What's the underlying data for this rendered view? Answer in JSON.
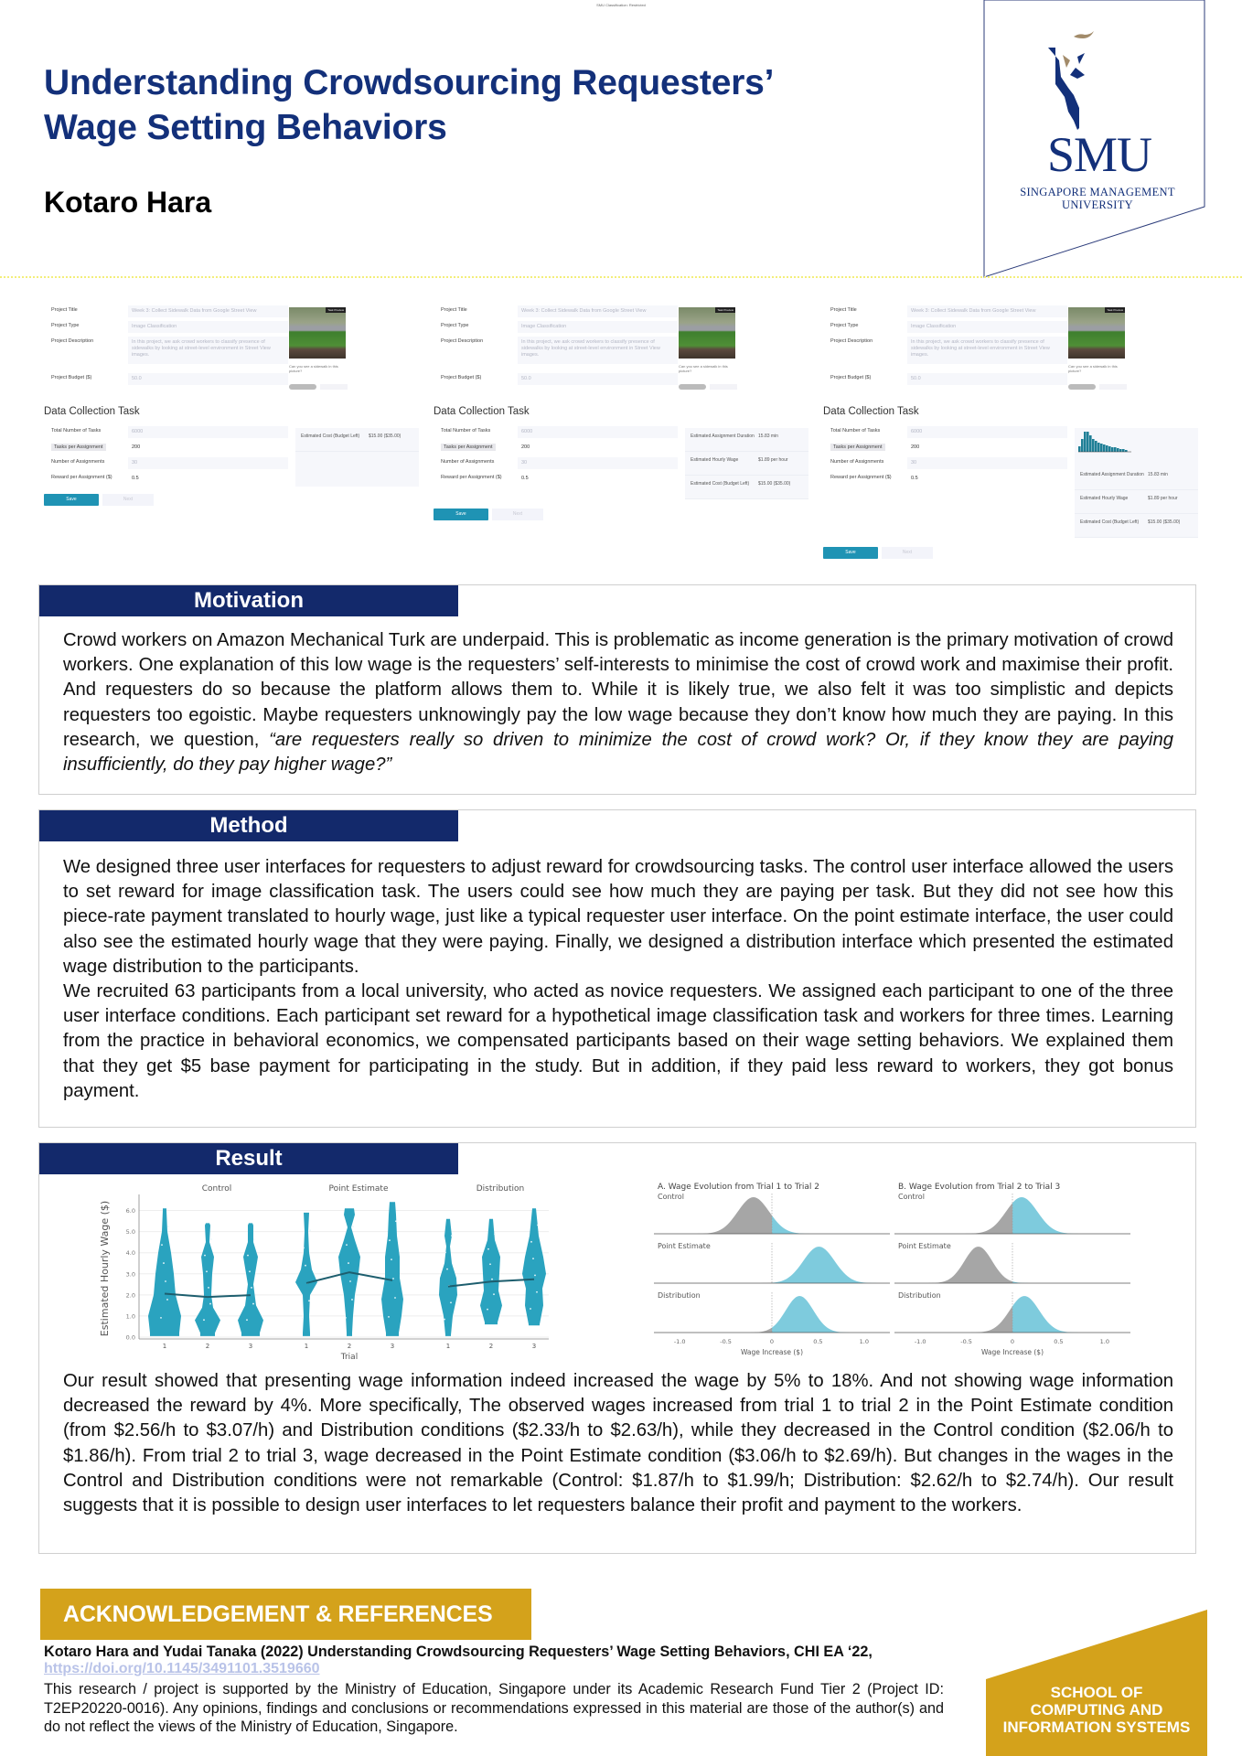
{
  "classification": "SMU Classification: Restricted",
  "header": {
    "title_line1": "Understanding Crowdsourcing Requesters’",
    "title_line2": "Wage Setting Behaviors",
    "author": "Kotaro Hara",
    "logo": {
      "name": "SMU",
      "subtitle_line1": "SINGAPORE MANAGEMENT",
      "subtitle_line2": "UNIVERSITY"
    }
  },
  "ui_screenshots": {
    "project_fields": [
      {
        "label": "Project Title",
        "value": "Week 3: Collect Sidewalk Data from Google Street View"
      },
      {
        "label": "Project Type",
        "value": "Image Classification"
      },
      {
        "label": "Project Description",
        "value": "In this project, we ask crowd workers to classify presence of sidewalks by looking at street-level environment in Street View images."
      },
      {
        "label": "Project Budget ($)",
        "value": "50.0"
      }
    ],
    "preview": {
      "tag": "Task Preview",
      "question": "Can you see a sidewalk in this picture?",
      "yes": "Yes",
      "no": "No"
    },
    "section_title": "Data Collection Task",
    "task_fields": [
      {
        "label": "Total Number of Tasks",
        "value": "6000"
      },
      {
        "label": "Tasks per Assignment",
        "value": "200"
      },
      {
        "label": "Number of Assignments",
        "value": "30"
      },
      {
        "label": "Reward per Assignment ($)",
        "value": "0.5"
      }
    ],
    "side_info": {
      "duration_label": "Estimated Assignment Duration",
      "duration_value": "15.83 min",
      "wage_label": "Estimated Hourly Wage",
      "wage_value": "$1.89 per hour",
      "cost_label": "Estimated Cost (Budget Left)",
      "cost_value": "$15.00 ($35.00)"
    },
    "histogram_axis": {
      "min": "0",
      "max": "100"
    },
    "save_label": "Save",
    "next_label": "Next",
    "variants": [
      "Control",
      "Point Estimate",
      "Distribution"
    ]
  },
  "motivation": {
    "heading": "Motivation",
    "text": "Crowd workers on Amazon Mechanical Turk are underpaid. This is problematic as income generation is the primary motivation of crowd workers. One explanation of this low wage is the requesters’ self-interests to minimise the cost of crowd work and maximise their profit. And requesters do so because the platform allows them to. While it is likely true, we also felt it was too simplistic and depicts requesters too egoistic. Maybe requesters unknowingly pay the low wage because they don’t know how much they are paying. In this research, we question, ",
    "question": "“are requesters really so driven to minimize the cost of crowd work? Or, if they know they are paying insufficiently, do they pay higher wage?”"
  },
  "method": {
    "heading": "Method",
    "paragraph1": "We designed three user interfaces for requesters to adjust reward for crowdsourcing tasks. The control user interface allowed the users to set reward for image classification task. The users could see how much they are paying per task. But they did not see how this piece-rate payment translated to hourly wage, just like a typical requester user interface. On the point estimate interface, the user could also see the estimated hourly wage that they were paying. Finally, we designed a distribution interface which presented the estimated wage distribution to the participants.",
    "paragraph2": "We recruited 63 participants from a local university, who acted as novice requesters. We assigned each participant to one of the three user interface conditions. Each participant set reward for a hypothetical image classification task and workers for three times. Learning from the practice in behavioral economics, we compensated participants based on their wage setting behaviors. We explained them that they get $5 base payment for participating in the study. But in addition, if they paid less reward to workers, they got bonus payment."
  },
  "result": {
    "heading": "Result",
    "text": "Our result showed that presenting wage information indeed increased the wage by 5% to 18%. And not showing wage information decreased the reward by 4%. More specifically, The observed wages increased from trial 1 to trial 2 in the Point Estimate condition (from $2.56/h to $3.07/h) and Distribution conditions ($2.33/h to $2.63/h), while they decreased in the Control condition ($2.06/h to $1.86/h). From trial 2 to trial 3, wage decreased in the Point Estimate condition ($3.06/h to $2.69/h). But changes in the wages in the Control and Distribution conditions were not remarkable (Control: $1.87/h to $1.99/h; Distribution: $2.62/h to $2.74/h). Our result suggests that it is possible to design user interfaces to let requesters balance their profit and payment to the workers."
  },
  "chart_data": [
    {
      "type": "violin",
      "title": "",
      "xlabel": "Trial",
      "ylabel": "Estimated Hourly Wage ($)",
      "ylim": [
        0,
        6.5
      ],
      "yticks": [
        "0.0",
        "1.0",
        "2.0",
        "3.0",
        "4.0",
        "5.0",
        "6.0"
      ],
      "categories": [
        "1",
        "2",
        "3"
      ],
      "color": "#2aa3bf",
      "panels": [
        {
          "name": "Control",
          "means": [
            2.06,
            1.9,
            1.99
          ],
          "max": [
            6.1,
            5.4,
            5.4
          ],
          "min": [
            0.05,
            0.05,
            0.05
          ]
        },
        {
          "name": "Point Estimate",
          "means": [
            2.56,
            3.07,
            2.69
          ],
          "max": [
            5.9,
            6.1,
            6.4
          ],
          "min": [
            0.05,
            0.05,
            0.05
          ]
        },
        {
          "name": "Distribution",
          "means": [
            2.4,
            2.63,
            2.74
          ],
          "max": [
            5.6,
            5.6,
            6.1
          ],
          "min": [
            0.05,
            0.6,
            0.55
          ]
        }
      ]
    },
    {
      "type": "area",
      "title": "A. Wage Evolution from Trial 1 to Trial 2",
      "xlabel": "Wage Increase ($)",
      "xlim": [
        -1.2,
        1.2
      ],
      "xticks": [
        "-1.0",
        "-0.5",
        "0",
        "0.5",
        "1.0"
      ],
      "negative_color": "#a6a6a6",
      "positive_color": "#7ecbdd",
      "series": [
        {
          "name": "Control",
          "mean": -0.2,
          "sd": 0.17
        },
        {
          "name": "Point Estimate",
          "mean": 0.51,
          "sd": 0.17
        },
        {
          "name": "Distribution",
          "mean": 0.3,
          "sd": 0.15
        }
      ]
    },
    {
      "type": "area",
      "title": "B. Wage Evolution from Trial 2 to Trial 3",
      "xlabel": "Wage Increase ($)",
      "xlim": [
        -1.2,
        1.2
      ],
      "xticks": [
        "-1.0",
        "-0.5",
        "0",
        "0.5",
        "1.0"
      ],
      "negative_color": "#a6a6a6",
      "positive_color": "#7ecbdd",
      "series": [
        {
          "name": "Control",
          "mean": 0.1,
          "sd": 0.17
        },
        {
          "name": "Point Estimate",
          "mean": -0.37,
          "sd": 0.15
        },
        {
          "name": "Distribution",
          "mean": 0.13,
          "sd": 0.16
        }
      ]
    }
  ],
  "acknowledgement": {
    "heading": "ACKNOWLEDGEMENT & REFERENCES",
    "reference": "Kotaro Hara and Yudai Tanaka (2022) Understanding Crowdsourcing Requesters’ Wage Setting Behaviors, CHI EA ‘22,",
    "link": "https://doi.org/10.1145/3491101.3519660",
    "body": "This research / project is supported by the Ministry of Education, Singapore under its Academic Research Fund Tier 2 (Project ID: T2EP20220-0016). Any opinions, findings and conclusions or recommendations expressed in this material are those of the author(s) and do not reflect the views of the Ministry of Education, Singapore."
  },
  "school": {
    "line1": "SCHOOL OF",
    "line2": "COMPUTING AND",
    "line3": "INFORMATION SYSTEMS"
  },
  "colors": {
    "title_navy": "#13307a",
    "section_navy": "#13296b",
    "gold": "#d4a21b",
    "teal": "#2aa3bf"
  }
}
